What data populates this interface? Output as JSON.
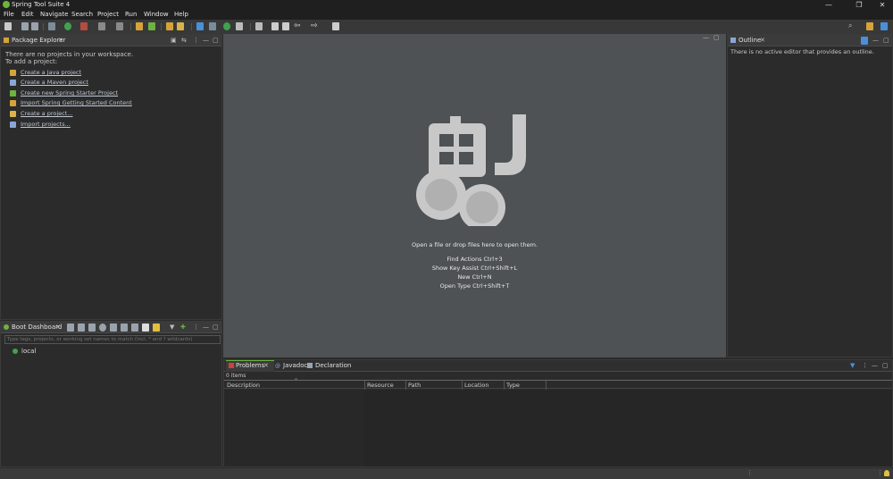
{
  "window": {
    "title": "Spring Tool Suite 4",
    "controls": [
      "—",
      "❐",
      "✕"
    ]
  },
  "menu": [
    "File",
    "Edit",
    "Navigate",
    "Search",
    "Project",
    "Run",
    "Window",
    "Help"
  ],
  "package_explorer": {
    "title": "Package Explorer",
    "msg1": "There are no projects in your workspace.",
    "msg2": "To add a project:",
    "links": [
      "Create a Java project",
      "Create a Maven project",
      "Create new Spring Starter Project",
      "Import Spring Getting Started Content",
      "Create a project...",
      "Import projects..."
    ]
  },
  "boot_dashboard": {
    "title": "Boot Dashboard",
    "filter_placeholder": "Type tags, projects, or working set names to match (incl. * and ? wildcards)",
    "item": "local"
  },
  "editor": {
    "open_hint": "Open a file or drop files here to open them.",
    "shortcuts": [
      "Find Actions Ctrl+3",
      "Show Key Assist Ctrl+Shift+L",
      "New Ctrl+N",
      "Open Type Ctrl+Shift+T"
    ]
  },
  "outline": {
    "title": "Outline",
    "msg": "There is no active editor that provides an outline."
  },
  "bottom": {
    "tabs": [
      "Problems",
      "Javadoc",
      "Declaration"
    ],
    "count": "0 items",
    "columns": [
      "Description",
      "Resource",
      "Path",
      "Location",
      "Type"
    ]
  },
  "colors": {
    "spring_green": "#6db33f",
    "editor_bg": "#4e5254"
  }
}
